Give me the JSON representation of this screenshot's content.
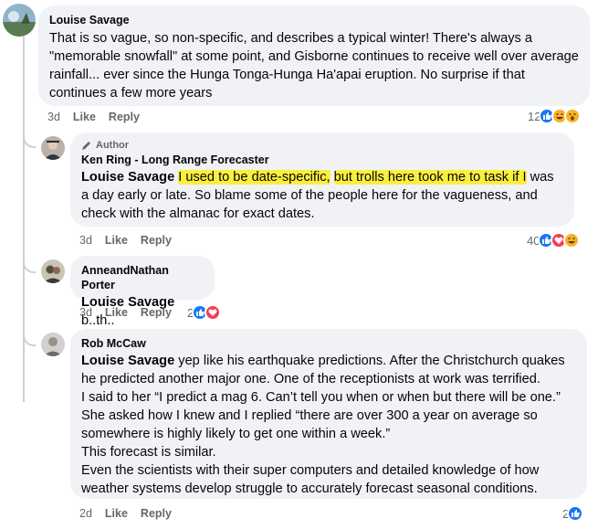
{
  "colors": {
    "like": "#1877f2",
    "love": "#f33e58",
    "haha": "#f7b125",
    "highlight": "#ffec00",
    "muted": "#65676b",
    "bubble": "#f0f2f5"
  },
  "labels": {
    "like": "Like",
    "reply": "Reply"
  },
  "comments": [
    {
      "author": "Louise Savage",
      "text": "That is so vague, so non-specific, and describes a typical winter! There's always a \"memorable snowfall\" at some point, and Gisborne continues to receive well over average rainfall... ever since the Hunga Tonga-Hunga Ha'apai eruption. No surprise if that continues a few more years",
      "time": "3d",
      "reaction_count": "12",
      "reactions": [
        "like-icon",
        "haha-icon",
        "wow-icon"
      ]
    },
    {
      "badge": "Author",
      "author": "Ken Ring - Long Range Forecaster",
      "mention": "Louise Savage",
      "text_highlighted_1": "I used to be date-specific,",
      "text_plain_1": " ",
      "text_highlighted_2": "but trolls here took me to task if I",
      "text_rest": " was a day early or late. So blame some of the people here for the vagueness, and check with the almanac for exact dates.",
      "time": "3d",
      "reaction_count": "40",
      "reactions": [
        "like-icon",
        "love-icon",
        "haha-icon"
      ]
    },
    {
      "author": "AnneandNathan Porter",
      "mention": "Louise Savage",
      "text": "b..th..",
      "time": "3d",
      "reaction_count": "2",
      "reactions": [
        "like-icon",
        "love-icon"
      ]
    },
    {
      "author": "Rob McCaw",
      "mention": "Louise Savage",
      "text_lines": [
        "yep like his earthquake predictions. After the Christchurch quakes he predicted another major one. One of the receptionists at work was terrified.",
        "I said to her “I predict a mag 6. Can’t tell you when or when but there will be one.”",
        "She asked how I knew and I replied “there are over 300 a year on average so somewhere is highly likely to get one within a week.”",
        "This forecast is similar.",
        "Even the scientists with their super computers and detailed knowledge of how weather systems develop struggle to accurately forecast seasonal conditions."
      ],
      "time": "2d",
      "reaction_count": "2",
      "reactions": [
        "like-icon"
      ]
    }
  ]
}
